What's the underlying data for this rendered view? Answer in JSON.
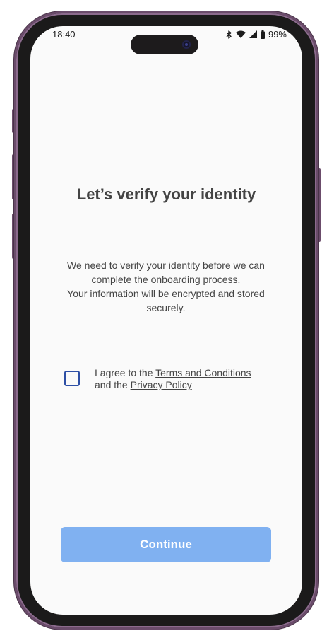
{
  "status_bar": {
    "time": "18:40",
    "battery": "99%",
    "icons": [
      "bluetooth-icon",
      "wifi-icon",
      "signal-icon",
      "battery-icon"
    ]
  },
  "screen": {
    "title": "Let’s verify your identity",
    "description_line1": "We need to verify your identity before we can complete the onboarding process.",
    "description_line2": "Your information will be encrypted and stored securely.",
    "agreement": {
      "prefix": "I agree to the ",
      "terms_link": "Terms and Conditions",
      "middle": "and the ",
      "privacy_link": "Privacy Policy",
      "checked": false
    },
    "continue_label": "Continue"
  },
  "colors": {
    "button_bg": "#80b1f1",
    "checkbox_border": "#2d4fa5",
    "text": "#444444",
    "frame": "#6b4c6b"
  }
}
